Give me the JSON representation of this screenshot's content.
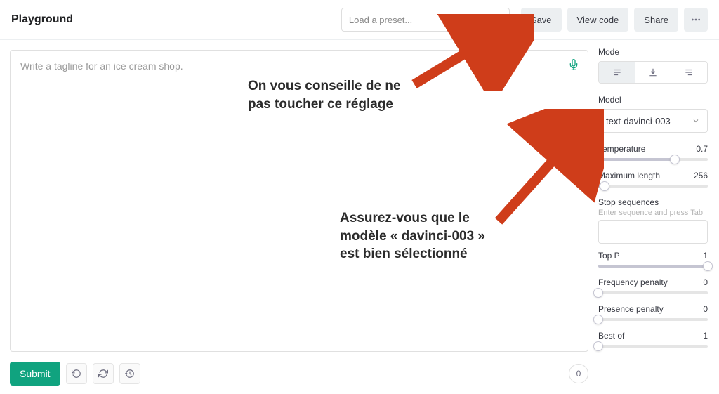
{
  "header": {
    "title": "Playground",
    "preset_placeholder": "Load a preset...",
    "save": "Save",
    "view_code": "View code",
    "share": "Share"
  },
  "editor": {
    "placeholder": "Write a tagline for an ice cream shop."
  },
  "footer": {
    "submit": "Submit",
    "token_count": "0"
  },
  "sidebar": {
    "mode_label": "Mode",
    "model_label": "Model",
    "model_value": "text-davinci-003",
    "temperature": {
      "label": "Temperature",
      "value": "0.7",
      "pct": 70
    },
    "max_length": {
      "label": "Maximum length",
      "value": "256",
      "pct": 6
    },
    "stop": {
      "label": "Stop sequences",
      "hint": "Enter sequence and press Tab"
    },
    "top_p": {
      "label": "Top P",
      "value": "1",
      "pct": 100
    },
    "freq": {
      "label": "Frequency penalty",
      "value": "0",
      "pct": 0
    },
    "pres": {
      "label": "Presence penalty",
      "value": "0",
      "pct": 0
    },
    "best": {
      "label": "Best of",
      "value": "1",
      "pct": 0
    }
  },
  "annotations": {
    "a1": "On vous conseille de ne pas toucher ce réglage",
    "a2": "Assurez-vous que le modèle « davinci-003 » est bien sélectionné"
  }
}
